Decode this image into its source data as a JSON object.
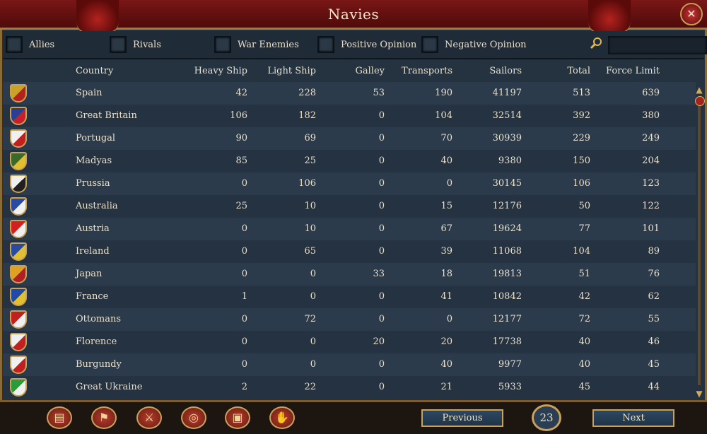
{
  "window": {
    "title": "Navies",
    "close_icon": "close-icon"
  },
  "filters": [
    {
      "label": "Allies",
      "checked": false
    },
    {
      "label": "Rivals",
      "checked": false
    },
    {
      "label": "War Enemies",
      "checked": false
    },
    {
      "label": "Positive Opinion",
      "checked": false
    },
    {
      "label": "Negative Opinion",
      "checked": false
    }
  ],
  "search": {
    "icon": "search-icon",
    "value": ""
  },
  "columns": [
    "Country",
    "Heavy Ship",
    "Light Ship",
    "Galley",
    "Transports",
    "Sailors",
    "Total",
    "Force Limit"
  ],
  "rows": [
    {
      "country": "Spain",
      "heavy": "42",
      "light": "228",
      "galley": "53",
      "transports": "190",
      "sailors": "41197",
      "total": "513",
      "force_limit": "639",
      "colors": [
        "#c9a227",
        "#b5221b"
      ]
    },
    {
      "country": "Great Britain",
      "heavy": "106",
      "light": "182",
      "galley": "0",
      "transports": "104",
      "sailors": "32514",
      "total": "392",
      "force_limit": "380",
      "colors": [
        "#2a3f8f",
        "#c8202a"
      ]
    },
    {
      "country": "Portugal",
      "heavy": "90",
      "light": "69",
      "galley": "0",
      "transports": "70",
      "sailors": "30939",
      "total": "229",
      "force_limit": "249",
      "colors": [
        "#f0f0f0",
        "#c02020"
      ]
    },
    {
      "country": "Madyas",
      "heavy": "85",
      "light": "25",
      "galley": "0",
      "transports": "40",
      "sailors": "9380",
      "total": "150",
      "force_limit": "204",
      "colors": [
        "#3a6a2a",
        "#e0c030"
      ]
    },
    {
      "country": "Prussia",
      "heavy": "0",
      "light": "106",
      "galley": "0",
      "transports": "0",
      "sailors": "30145",
      "total": "106",
      "force_limit": "123",
      "colors": [
        "#f0f0f0",
        "#202020"
      ]
    },
    {
      "country": "Australia",
      "heavy": "25",
      "light": "10",
      "galley": "0",
      "transports": "15",
      "sailors": "12176",
      "total": "50",
      "force_limit": "122",
      "colors": [
        "#2a4aa0",
        "#f0f0f0"
      ]
    },
    {
      "country": "Austria",
      "heavy": "0",
      "light": "10",
      "galley": "0",
      "transports": "67",
      "sailors": "19624",
      "total": "77",
      "force_limit": "101",
      "colors": [
        "#d02020",
        "#f0f0f0"
      ]
    },
    {
      "country": "Ireland",
      "heavy": "0",
      "light": "65",
      "galley": "0",
      "transports": "39",
      "sailors": "11068",
      "total": "104",
      "force_limit": "89",
      "colors": [
        "#2a4aa0",
        "#e0c030"
      ]
    },
    {
      "country": "Japan",
      "heavy": "0",
      "light": "0",
      "galley": "33",
      "transports": "18",
      "sailors": "19813",
      "total": "51",
      "force_limit": "76",
      "colors": [
        "#e0a020",
        "#b02020"
      ]
    },
    {
      "country": "France",
      "heavy": "1",
      "light": "0",
      "galley": "0",
      "transports": "41",
      "sailors": "10842",
      "total": "42",
      "force_limit": "62",
      "colors": [
        "#1f4aa8",
        "#e0c030"
      ]
    },
    {
      "country": "Ottomans",
      "heavy": "0",
      "light": "72",
      "galley": "0",
      "transports": "0",
      "sailors": "12177",
      "total": "72",
      "force_limit": "55",
      "colors": [
        "#c02020",
        "#f0f0f0"
      ]
    },
    {
      "country": "Florence",
      "heavy": "0",
      "light": "0",
      "galley": "20",
      "transports": "20",
      "sailors": "17738",
      "total": "40",
      "force_limit": "46",
      "colors": [
        "#f0f0f0",
        "#c02020"
      ]
    },
    {
      "country": "Burgundy",
      "heavy": "0",
      "light": "0",
      "galley": "0",
      "transports": "40",
      "sailors": "9977",
      "total": "40",
      "force_limit": "45",
      "colors": [
        "#f0f0f0",
        "#c02020"
      ]
    },
    {
      "country": "Great Ukraine",
      "heavy": "2",
      "light": "22",
      "galley": "0",
      "transports": "21",
      "sailors": "5933",
      "total": "45",
      "force_limit": "44",
      "colors": [
        "#2a9a3a",
        "#f0f0f0"
      ]
    }
  ],
  "bottom_buttons": [
    {
      "name": "ledger-icon",
      "glyph": "▤"
    },
    {
      "name": "flag-icon",
      "glyph": "⚑"
    },
    {
      "name": "crossed-swords-icon",
      "glyph": "⚔"
    },
    {
      "name": "coins-icon",
      "glyph": "◎"
    },
    {
      "name": "trade-goods-icon",
      "glyph": "▣"
    },
    {
      "name": "handshake-icon",
      "glyph": "✋"
    }
  ],
  "pagination": {
    "previous_label": "Previous",
    "next_label": "Next",
    "page": "23"
  }
}
